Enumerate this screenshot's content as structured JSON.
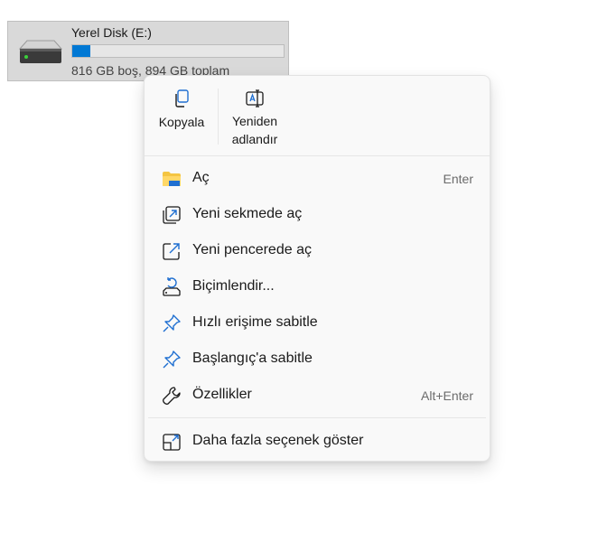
{
  "drive": {
    "name": "Yerel Disk (E:)",
    "space_text": "816 GB boş, 894 GB toplam",
    "used_fraction": 0.087,
    "icon": "hard-drive-icon"
  },
  "quick_actions": [
    {
      "label": "Kopyala",
      "icon": "copy-icon"
    },
    {
      "label_line1": "Yeniden",
      "label_line2": "adlandır",
      "icon": "rename-icon"
    }
  ],
  "menu_items": [
    {
      "label": "Aç",
      "shortcut": "Enter",
      "icon": "folder-icon"
    },
    {
      "label": "Yeni sekmede aç",
      "icon": "open-new-tab-icon"
    },
    {
      "label": "Yeni pencerede aç",
      "icon": "open-new-window-icon"
    },
    {
      "label": "Biçimlendir...",
      "icon": "format-drive-icon"
    },
    {
      "label": "Hızlı erişime sabitle",
      "icon": "pin-icon"
    },
    {
      "label": "Başlangıç'a sabitle",
      "icon": "pin-start-icon"
    },
    {
      "label": "Özellikler",
      "shortcut": "Alt+Enter",
      "icon": "wrench-icon"
    }
  ],
  "more_options": {
    "label": "Daha fazla seçenek göster",
    "icon": "show-more-icon"
  },
  "colors": {
    "accent": "#0078d4",
    "folder": "#f4c542",
    "menu_bg": "#f9f9f9"
  }
}
